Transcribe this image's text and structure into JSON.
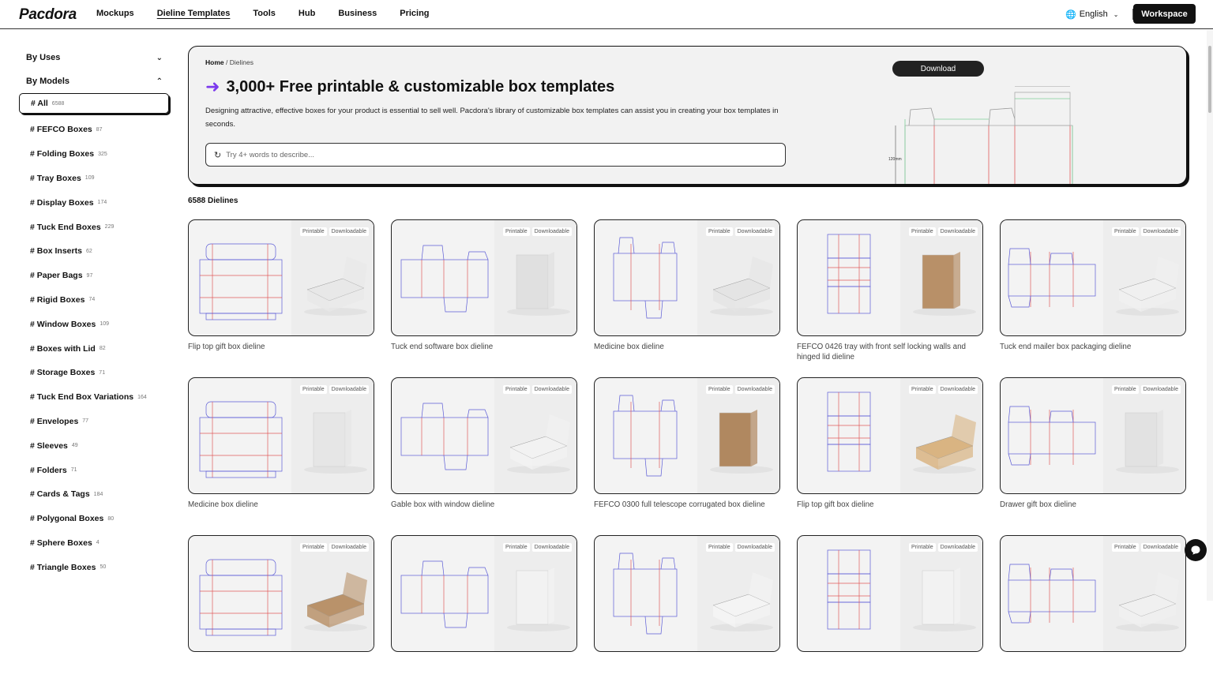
{
  "header": {
    "logo": "Pacdora",
    "nav": [
      "Mockups",
      "Dieline Templates",
      "Tools",
      "Hub",
      "Business",
      "Pricing"
    ],
    "active_nav": "Dieline Templates",
    "language": "English",
    "workspace_label": "Workspace"
  },
  "sidebar": {
    "by_uses": "By Uses",
    "by_models": "By Models",
    "items": [
      {
        "label": "# All",
        "count": "6588"
      },
      {
        "label": "# FEFCO Boxes",
        "count": "87"
      },
      {
        "label": "# Folding Boxes",
        "count": "325"
      },
      {
        "label": "# Tray Boxes",
        "count": "109"
      },
      {
        "label": "# Display Boxes",
        "count": "174"
      },
      {
        "label": "# Tuck End Boxes",
        "count": "229"
      },
      {
        "label": "# Box Inserts",
        "count": "62"
      },
      {
        "label": "# Paper Bags",
        "count": "97"
      },
      {
        "label": "# Rigid Boxes",
        "count": "74"
      },
      {
        "label": "# Window Boxes",
        "count": "109"
      },
      {
        "label": "# Boxes with Lid",
        "count": "82"
      },
      {
        "label": "# Storage Boxes",
        "count": "71"
      },
      {
        "label": "# Tuck End Box Variations",
        "count": "164"
      },
      {
        "label": "# Envelopes",
        "count": "77"
      },
      {
        "label": "# Sleeves",
        "count": "49"
      },
      {
        "label": "# Folders",
        "count": "71"
      },
      {
        "label": "# Cards & Tags",
        "count": "184"
      },
      {
        "label": "# Polygonal Boxes",
        "count": "80"
      },
      {
        "label": "# Sphere Boxes",
        "count": "4"
      },
      {
        "label": "# Triangle Boxes",
        "count": "50"
      }
    ]
  },
  "hero": {
    "breadcrumb_home": "Home",
    "breadcrumb_current": "Dielines",
    "title": "3,000+ Free printable & customizable box templates",
    "description": "Designing attractive, effective boxes for your product is essential to sell well. Pacdora's library of customizable box templates can assist you in creating your box templates in seconds.",
    "search_placeholder": "Try 4+ words to describe...",
    "download_label": "Download",
    "dimension_label": "120mm"
  },
  "results": {
    "count_label": "6588 Dielines",
    "tag_printable": "Printable",
    "tag_downloadable": "Downloadable",
    "cards": [
      {
        "title": "Flip top gift box dieline",
        "box_color": "#e8e8e8"
      },
      {
        "title": "Tuck end software box dieline",
        "box_color": "#e0e0e0"
      },
      {
        "title": "Medicine box dieline",
        "box_color": "#e4e4e4"
      },
      {
        "title": "FEFCO 0426 tray with front self locking walls and hinged lid dieline",
        "box_color": "#b89068"
      },
      {
        "title": "Tuck end mailer box packaging dieline",
        "box_color": "#f0f0f0"
      },
      {
        "title": "Medicine box dieline",
        "box_color": "#e6e6e6"
      },
      {
        "title": "Gable box with window dieline",
        "box_color": "#f2f2f2"
      },
      {
        "title": "FEFCO 0300 full telescope corrugated box dieline",
        "box_color": "#b08860"
      },
      {
        "title": "Flip top gift box dieline",
        "box_color": "#d9b482"
      },
      {
        "title": "Drawer gift box dieline",
        "box_color": "#e2e2e2"
      },
      {
        "title": "",
        "box_color": "#b9926a"
      },
      {
        "title": "",
        "box_color": "#f2f2f2"
      },
      {
        "title": "",
        "box_color": "#f4f4f4"
      },
      {
        "title": "",
        "box_color": "#f2f2f2"
      },
      {
        "title": "",
        "box_color": "#f0f0f0"
      }
    ]
  },
  "colors": {
    "accent": "#7c3aed",
    "dieline_cut": "#5b5bd6",
    "dieline_fold": "#e05a5a"
  }
}
